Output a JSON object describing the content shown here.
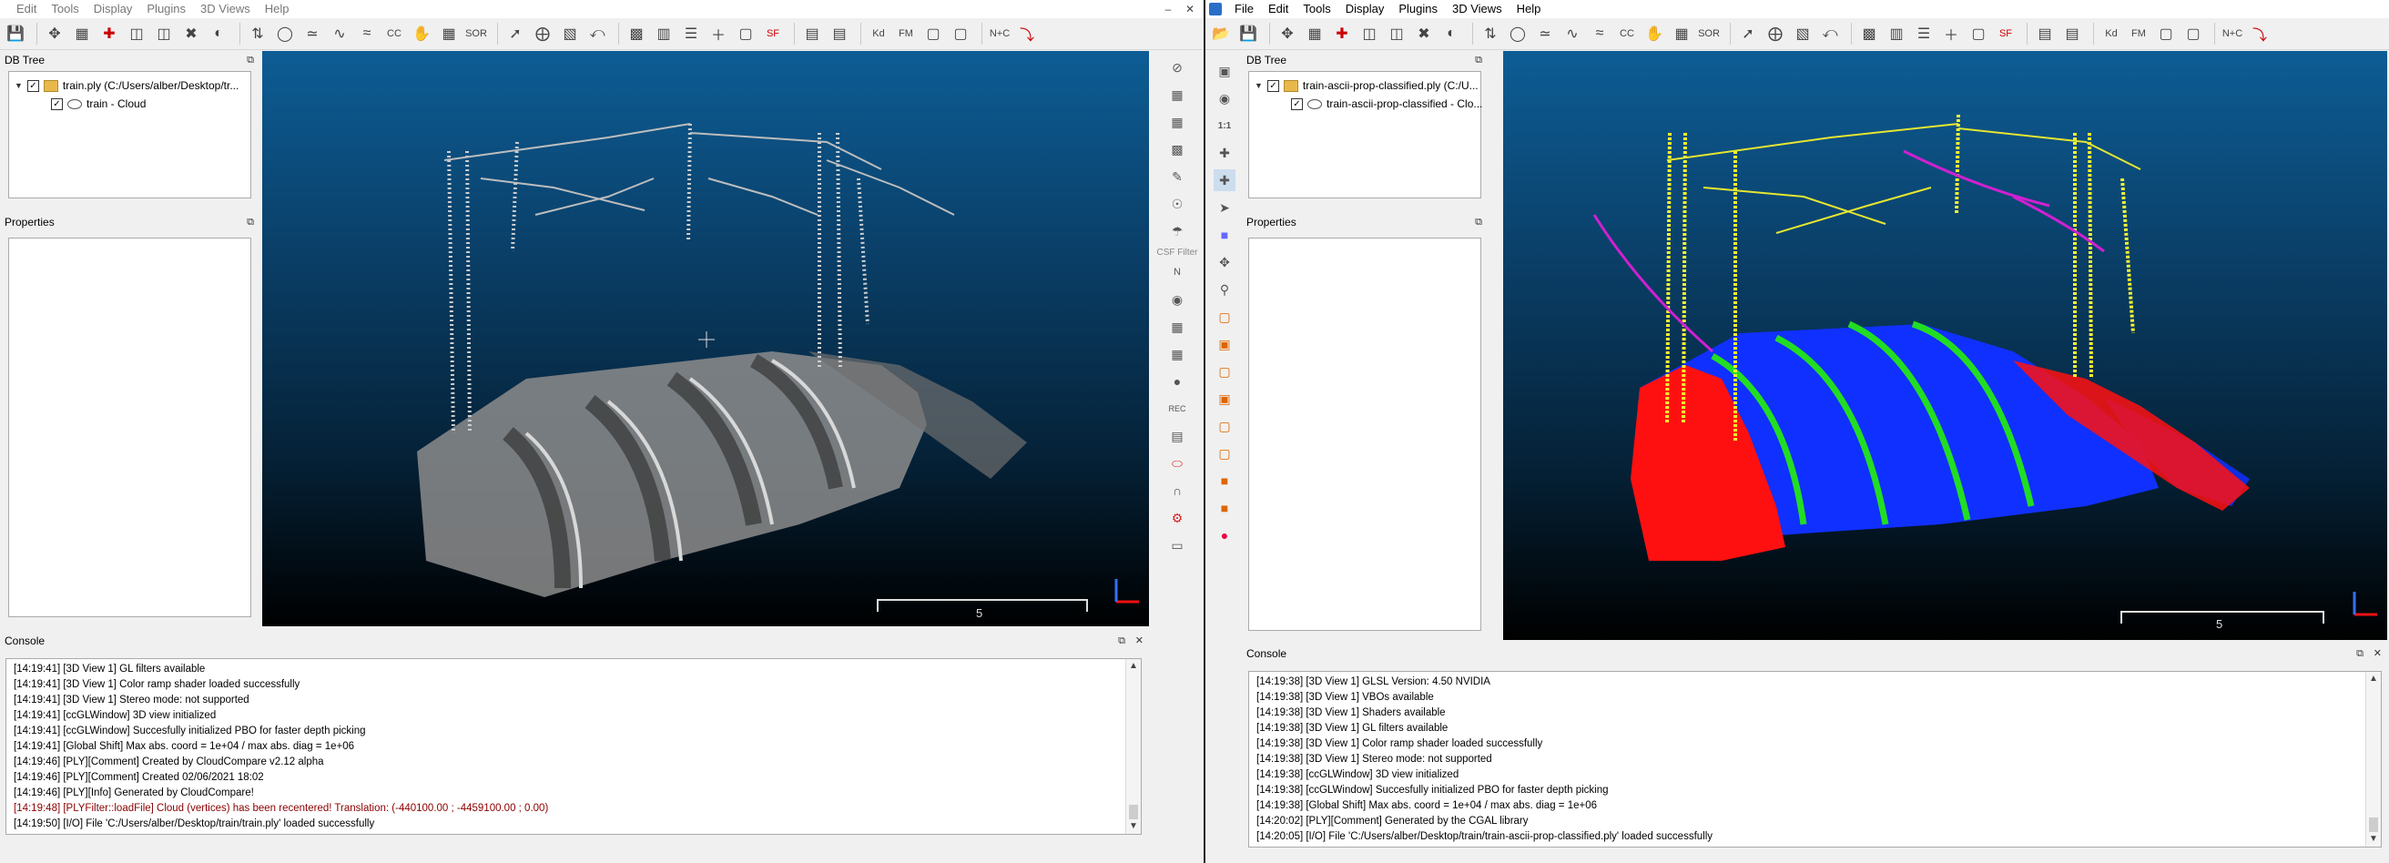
{
  "left": {
    "menu": [
      "Edit",
      "Tools",
      "Display",
      "Plugins",
      "3D Views",
      "Help"
    ],
    "db_tree_title": "DB Tree",
    "tree": {
      "root": "train.ply (C:/Users/alber/Desktop/tr...",
      "child": "train - Cloud"
    },
    "properties_title": "Properties",
    "console_title": "Console",
    "scale_label": "5",
    "side_label": "CSF Filter",
    "log": [
      {
        "text": "[14:19:41] [3D View 1] GL filters available",
        "warn": false
      },
      {
        "text": "[14:19:41] [3D View 1] Color ramp shader loaded successfully",
        "warn": false
      },
      {
        "text": "[14:19:41] [3D View 1] Stereo mode: not supported",
        "warn": false
      },
      {
        "text": "[14:19:41] [ccGLWindow] 3D view initialized",
        "warn": false
      },
      {
        "text": "[14:19:41] [ccGLWindow] Succesfully initialized PBO for faster depth picking",
        "warn": false
      },
      {
        "text": "[14:19:41] [Global Shift] Max abs. coord = 1e+04 / max abs. diag = 1e+06",
        "warn": false
      },
      {
        "text": "[14:19:46] [PLY][Comment] Created by CloudCompare v2.12 alpha",
        "warn": false
      },
      {
        "text": "[14:19:46] [PLY][Comment] Created 02/06/2021 18:02",
        "warn": false
      },
      {
        "text": "[14:19:46] [PLY][Info] Generated by CloudCompare!",
        "warn": false
      },
      {
        "text": "[14:19:48] [PLYFilter::loadFile] Cloud (vertices) has been recentered! Translation: (-440100.00 ; -4459100.00 ; 0.00)",
        "warn": true
      },
      {
        "text": "[14:19:50] [I/O] File 'C:/Users/alber/Desktop/train/train.ply' loaded successfully",
        "warn": false
      }
    ]
  },
  "right": {
    "menu": [
      "File",
      "Edit",
      "Tools",
      "Display",
      "Plugins",
      "3D Views",
      "Help"
    ],
    "db_tree_title": "DB Tree",
    "tree": {
      "root": "train-ascii-prop-classified.ply (C:/U...",
      "child": "train-ascii-prop-classified - Clo..."
    },
    "properties_title": "Properties",
    "console_title": "Console",
    "scale_label": "5",
    "log": [
      {
        "text": "[14:19:38] [3D View 1] GLSL Version: 4.50 NVIDIA",
        "warn": false
      },
      {
        "text": "[14:19:38] [3D View 1] VBOs available",
        "warn": false
      },
      {
        "text": "[14:19:38] [3D View 1] Shaders available",
        "warn": false
      },
      {
        "text": "[14:19:38] [3D View 1] GL filters available",
        "warn": false
      },
      {
        "text": "[14:19:38] [3D View 1] Color ramp shader loaded successfully",
        "warn": false
      },
      {
        "text": "[14:19:38] [3D View 1] Stereo mode: not supported",
        "warn": false
      },
      {
        "text": "[14:19:38] [ccGLWindow] 3D view initialized",
        "warn": false
      },
      {
        "text": "[14:19:38] [ccGLWindow] Succesfully initialized PBO for faster depth picking",
        "warn": false
      },
      {
        "text": "[14:19:38] [Global Shift] Max abs. coord = 1e+04 / max abs. diag = 1e+06",
        "warn": false
      },
      {
        "text": "[14:20:02] [PLY][Comment] Generated by the CGAL library",
        "warn": false
      },
      {
        "text": "[14:20:05] [I/O] File 'C:/Users/alber/Desktop/train/train-ascii-prop-classified.ply' loaded successfully",
        "warn": false
      }
    ]
  },
  "colors": {
    "ground": "#1030ff",
    "rail": "#22dd22",
    "vegetation": "#ff1010",
    "pole": "#f5f530",
    "wire": "#d020d0",
    "window_title_left": "#777777"
  }
}
